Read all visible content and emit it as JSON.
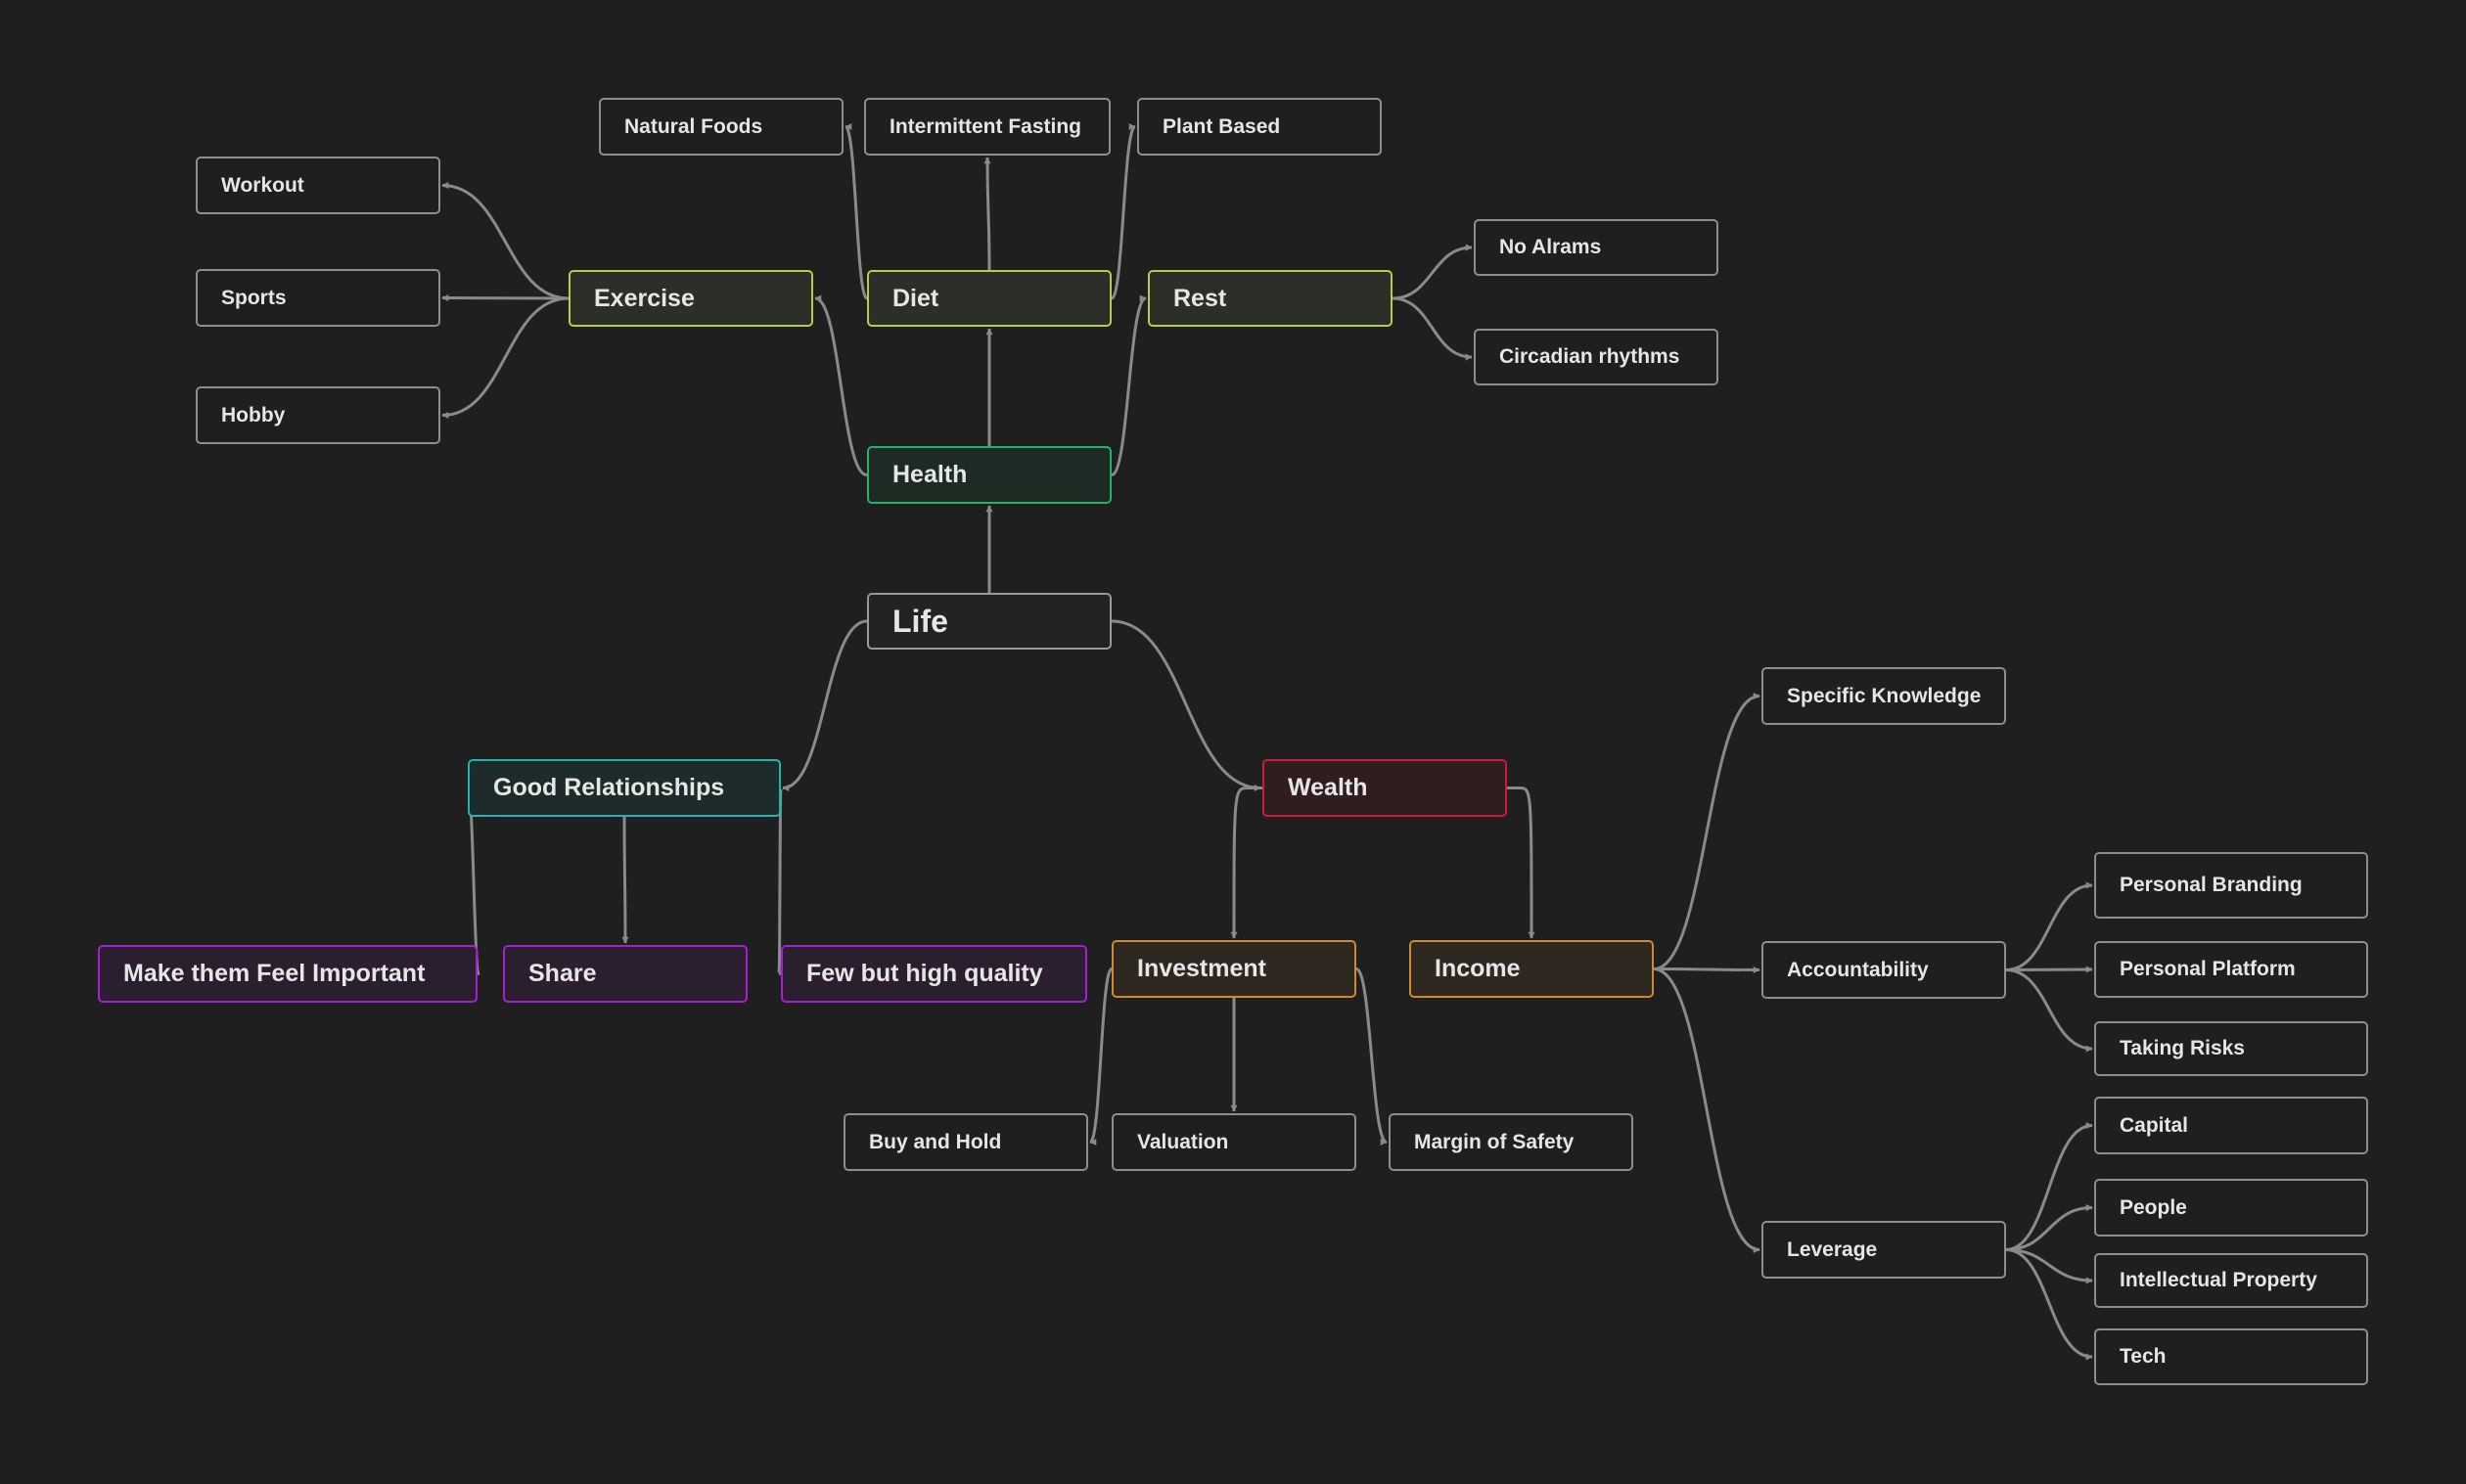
{
  "diagram": {
    "colors": {
      "background": "#1f1f1f",
      "edge": "#8a8a8a",
      "text": "#e6e6e6",
      "plain": "#8e8e8e",
      "root": "#9a9a9a",
      "green": "#1fb36b",
      "lime": "#b3cc52",
      "teal": "#1fb3b3",
      "red": "#d11a3a",
      "orange": "#d1892e",
      "purple": "#a31fd1"
    },
    "nodes": {
      "life": "Life",
      "health": "Health",
      "exercise": "Exercise",
      "diet": "Diet",
      "rest": "Rest",
      "workout": "Workout",
      "sports": "Sports",
      "hobby": "Hobby",
      "natural_foods": "Natural Foods",
      "intermittent_fasting": "Intermittent Fasting",
      "plant_based": "Plant Based",
      "no_alarms": "No Alrams",
      "circadian_rhythms": "Circadian rhythms",
      "good_relationships": "Good Relationships",
      "make_them_feel_important": "Make them Feel Important",
      "share": "Share",
      "few_but_high_quality": "Few but high quality",
      "wealth": "Wealth",
      "investment": "Investment",
      "income": "Income",
      "buy_and_hold": "Buy and Hold",
      "valuation": "Valuation",
      "margin_of_safety": "Margin of Safety",
      "specific_knowledge": "Specific Knowledge",
      "accountability": "Accountability",
      "leverage": "Leverage",
      "personal_branding": "Personal Branding",
      "personal_platform": "Personal Platform",
      "taking_risks": "Taking Risks",
      "capital": "Capital",
      "people": "People",
      "intellectual_property": "Intellectual Property",
      "tech": "Tech"
    },
    "edges": [
      [
        "life",
        "health"
      ],
      [
        "life",
        "good_relationships"
      ],
      [
        "life",
        "wealth"
      ],
      [
        "health",
        "exercise"
      ],
      [
        "health",
        "diet"
      ],
      [
        "health",
        "rest"
      ],
      [
        "exercise",
        "workout"
      ],
      [
        "exercise",
        "sports"
      ],
      [
        "exercise",
        "hobby"
      ],
      [
        "diet",
        "natural_foods"
      ],
      [
        "diet",
        "intermittent_fasting"
      ],
      [
        "diet",
        "plant_based"
      ],
      [
        "rest",
        "no_alarms"
      ],
      [
        "rest",
        "circadian_rhythms"
      ],
      [
        "good_relationships",
        "make_them_feel_important"
      ],
      [
        "good_relationships",
        "share"
      ],
      [
        "good_relationships",
        "few_but_high_quality"
      ],
      [
        "wealth",
        "investment"
      ],
      [
        "wealth",
        "income"
      ],
      [
        "investment",
        "buy_and_hold"
      ],
      [
        "investment",
        "valuation"
      ],
      [
        "investment",
        "margin_of_safety"
      ],
      [
        "income",
        "specific_knowledge"
      ],
      [
        "income",
        "accountability"
      ],
      [
        "income",
        "leverage"
      ],
      [
        "accountability",
        "personal_branding"
      ],
      [
        "accountability",
        "personal_platform"
      ],
      [
        "accountability",
        "taking_risks"
      ],
      [
        "leverage",
        "capital"
      ],
      [
        "leverage",
        "people"
      ],
      [
        "leverage",
        "intellectual_property"
      ],
      [
        "leverage",
        "tech"
      ]
    ]
  }
}
